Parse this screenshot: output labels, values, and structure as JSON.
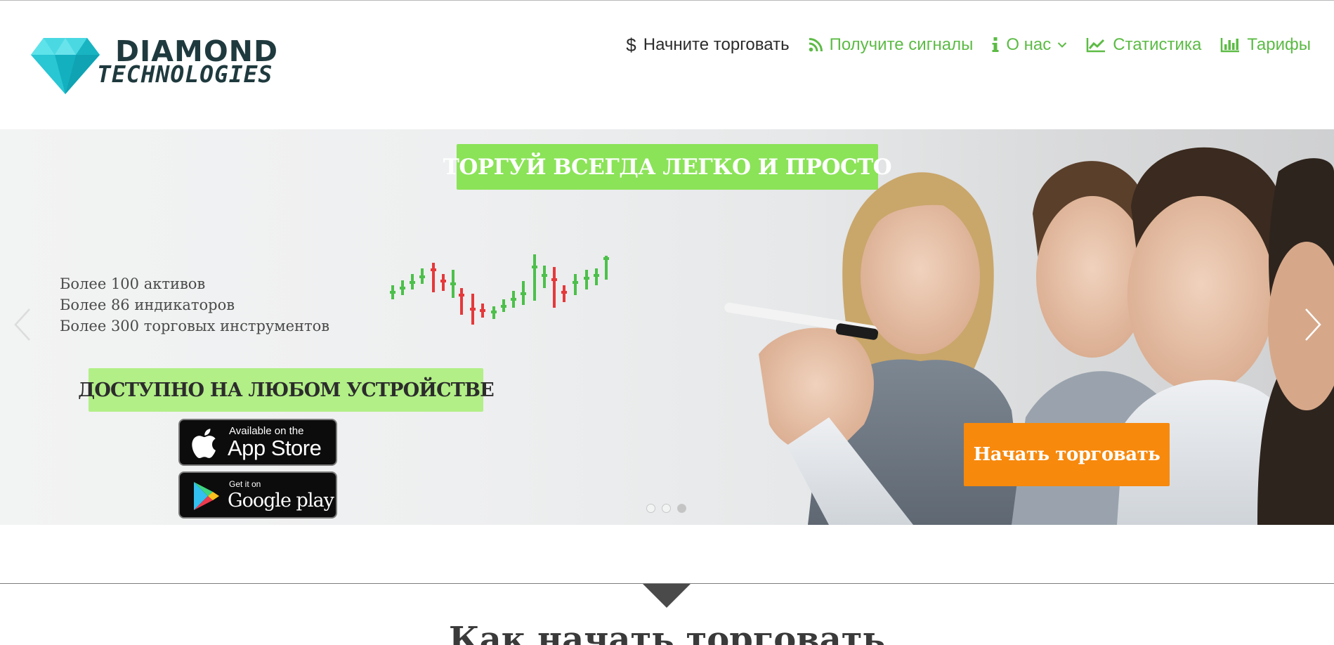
{
  "brand": {
    "name_line1": "DIAMOND",
    "name_line2": "TECHNOLOGIES",
    "logo_icon": "diamond-icon",
    "logo_color": "#22c9d6"
  },
  "nav": {
    "items": [
      {
        "label": "Начните торговать",
        "icon": "dollar-icon"
      },
      {
        "label": "Получите сигналы",
        "icon": "rss-icon"
      },
      {
        "label": "О нас",
        "icon": "info-icon",
        "dropdown": true
      },
      {
        "label": "Статистика",
        "icon": "line-chart-icon"
      },
      {
        "label": "Тарифы",
        "icon": "bar-chart-icon"
      }
    ],
    "accent_color": "#5cbb45"
  },
  "hero": {
    "headline": "ТОРГУЙ ВСЕГДА ЛЕГКО И ПРОСТО",
    "features": [
      "Более 100 активов",
      "Более 86 индикаторов",
      "Более 300 торговых инструментов"
    ],
    "device_banner": "ДОСТУПНО НА ЛЮБОМ УСТРОЙСТВЕ",
    "app_store": {
      "small": "Available on the",
      "big": "App Store"
    },
    "google_play": {
      "small": "Get it on",
      "big": "Google play"
    },
    "cta_label": "Начать торговать",
    "slides_total": 3,
    "active_slide": 3,
    "colors": {
      "headline_bg": "#8be358",
      "banner_bg": "#b2ef87",
      "cta_bg": "#f7890d",
      "bull": "#4cc04a",
      "bear": "#e5393b"
    }
  },
  "section": {
    "title": "Как начать торговать"
  }
}
